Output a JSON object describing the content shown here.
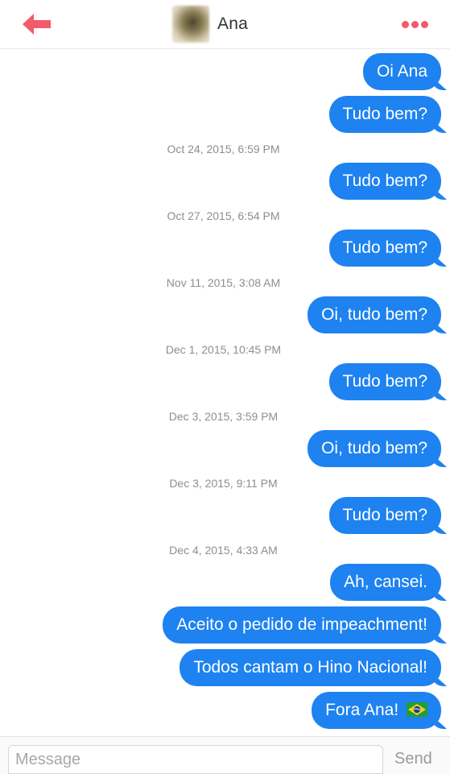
{
  "header": {
    "contact_name": "Ana",
    "back_icon": "arrow-left-icon",
    "more_icon": "more-dots-icon",
    "accent_color": "#f25c6a"
  },
  "messages": [
    {
      "type": "bubble",
      "text": "Oi Ana"
    },
    {
      "type": "bubble",
      "text": "Tudo bem?"
    },
    {
      "type": "timestamp",
      "text": "Oct 24, 2015, 6:59 PM"
    },
    {
      "type": "bubble",
      "text": "Tudo bem?"
    },
    {
      "type": "timestamp",
      "text": "Oct 27, 2015, 6:54 PM"
    },
    {
      "type": "bubble",
      "text": "Tudo bem?"
    },
    {
      "type": "timestamp",
      "text": "Nov 11, 2015, 3:08 AM"
    },
    {
      "type": "bubble",
      "text": "Oi, tudo bem?"
    },
    {
      "type": "timestamp",
      "text": "Dec 1, 2015, 10:45 PM"
    },
    {
      "type": "bubble",
      "text": "Tudo bem?"
    },
    {
      "type": "timestamp",
      "text": "Dec 3, 2015, 3:59 PM"
    },
    {
      "type": "bubble",
      "text": "Oi, tudo bem?"
    },
    {
      "type": "timestamp",
      "text": "Dec 3, 2015, 9:11 PM"
    },
    {
      "type": "bubble",
      "text": "Tudo bem?"
    },
    {
      "type": "timestamp",
      "text": "Dec 4, 2015, 4:33 AM"
    },
    {
      "type": "bubble",
      "text": "Ah, cansei."
    },
    {
      "type": "bubble",
      "text": "Aceito o pedido de impeachment!"
    },
    {
      "type": "bubble",
      "text": "Todos cantam o Hino Nacional!"
    },
    {
      "type": "bubble",
      "text": "Fora Ana!",
      "emoji": "brazil-flag-icon"
    }
  ],
  "composer": {
    "placeholder": "Message",
    "send_label": "Send"
  },
  "colors": {
    "bubble": "#1e82f0",
    "timestamp": "#8e8e93"
  }
}
